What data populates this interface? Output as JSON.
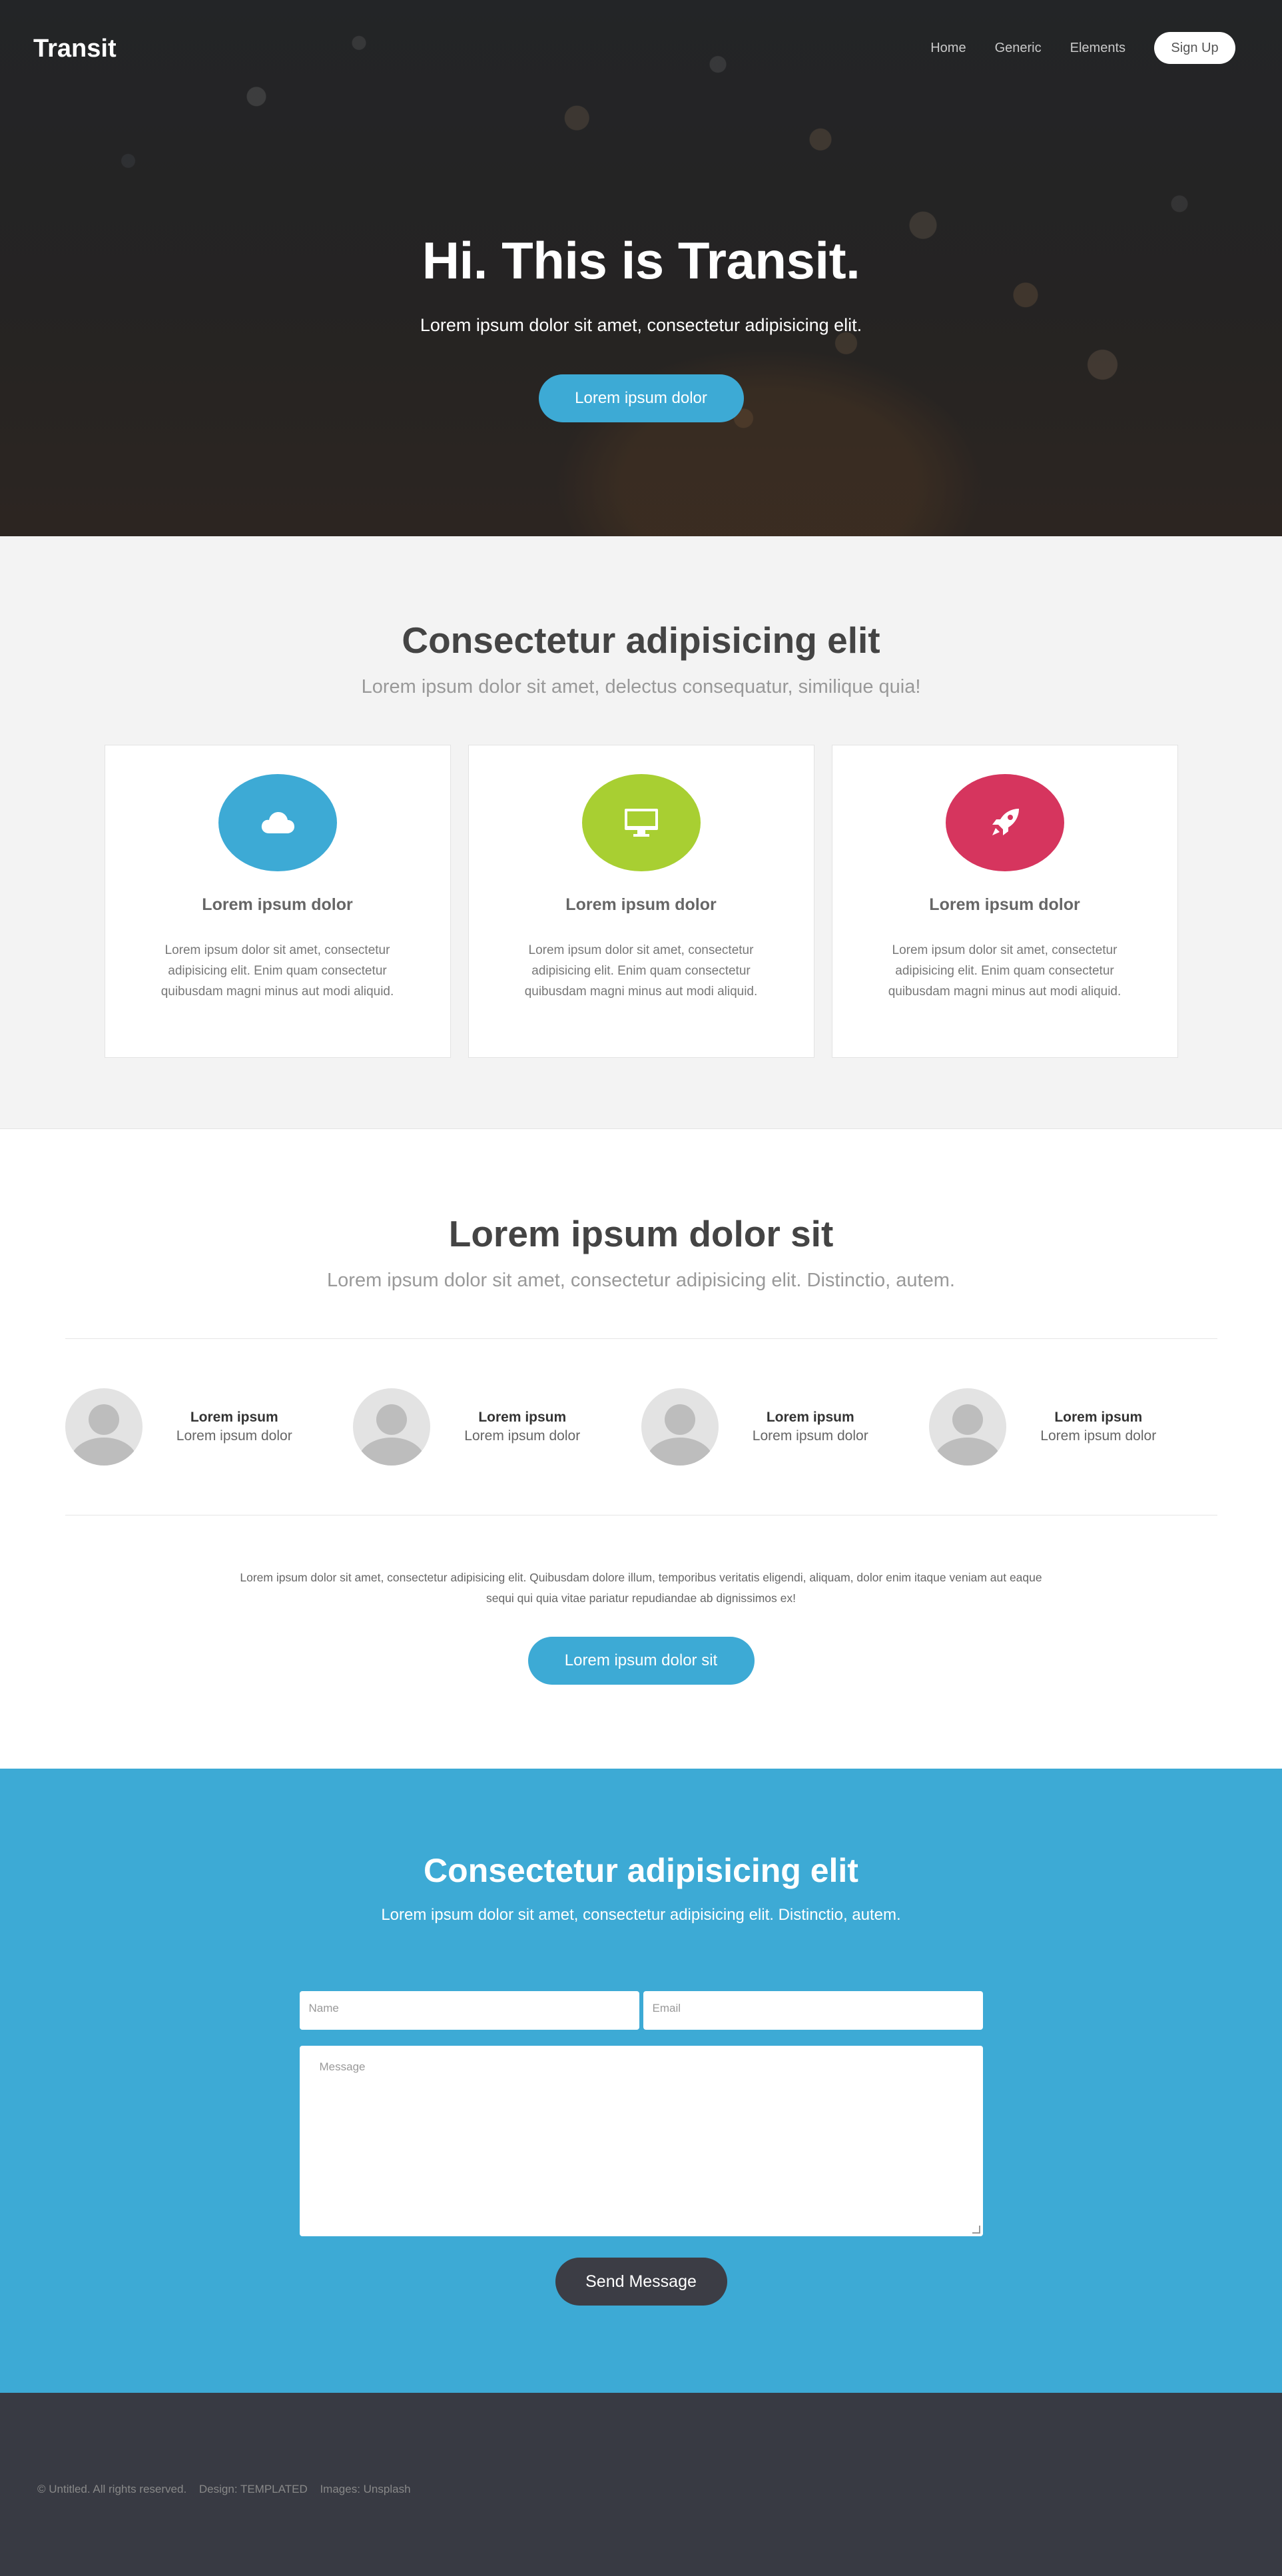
{
  "header": {
    "logo": "Transit",
    "nav": [
      {
        "label": "Home"
      },
      {
        "label": "Generic"
      },
      {
        "label": "Elements"
      }
    ],
    "signup_label": "Sign Up"
  },
  "banner": {
    "title": "Hi. This is Transit.",
    "subtitle": "Lorem ipsum dolor sit amet, consectetur adipisicing elit.",
    "button_label": "Lorem ipsum dolor"
  },
  "features": {
    "title": "Consectetur adipisicing elit",
    "subtitle": "Lorem ipsum dolor sit amet, delectus consequatur, similique quia!",
    "cards": [
      {
        "icon": "cloud-icon",
        "color": "#3daad5",
        "title": "Lorem ipsum dolor",
        "text": "Lorem ipsum dolor sit amet, consectetur adipisicing elit. Enim quam consectetur quibusdam magni minus aut modi aliquid."
      },
      {
        "icon": "desktop-icon",
        "color": "#a8cf32",
        "title": "Lorem ipsum dolor",
        "text": "Lorem ipsum dolor sit amet, consectetur adipisicing elit. Enim quam consectetur quibusdam magni minus aut modi aliquid."
      },
      {
        "icon": "rocket-icon",
        "color": "#d6355e",
        "title": "Lorem ipsum dolor",
        "text": "Lorem ipsum dolor sit amet, consectetur adipisicing elit. Enim quam consectetur quibusdam magni minus aut modi aliquid."
      }
    ]
  },
  "team": {
    "title": "Lorem ipsum dolor sit",
    "subtitle": "Lorem ipsum dolor sit amet, consectetur adipisicing elit. Distinctio, autem.",
    "people": [
      {
        "name": "Lorem ipsum",
        "role": "Lorem ipsum dolor"
      },
      {
        "name": "Lorem ipsum",
        "role": "Lorem ipsum dolor"
      },
      {
        "name": "Lorem ipsum",
        "role": "Lorem ipsum dolor"
      },
      {
        "name": "Lorem ipsum",
        "role": "Lorem ipsum dolor"
      }
    ],
    "paragraph": "Lorem ipsum dolor sit amet, consectetur adipisicing elit. Quibusdam dolore illum, temporibus veritatis eligendi, aliquam, dolor enim itaque veniam aut eaque sequi qui quia vitae pariatur repudiandae ab dignissimos ex!",
    "button_label": "Lorem ipsum dolor sit"
  },
  "contact": {
    "title": "Consectetur adipisicing elit",
    "subtitle": "Lorem ipsum dolor sit amet, consectetur adipisicing elit. Distinctio, autem.",
    "name_placeholder": "Name",
    "email_placeholder": "Email",
    "message_placeholder": "Message",
    "send_label": "Send Message"
  },
  "footer": {
    "copyright": "© Untitled. All rights reserved.",
    "design": "Design: TEMPLATED",
    "images": "Images: Unsplash"
  },
  "colors": {
    "accent": "#3daad5",
    "dark": "#383a43"
  }
}
